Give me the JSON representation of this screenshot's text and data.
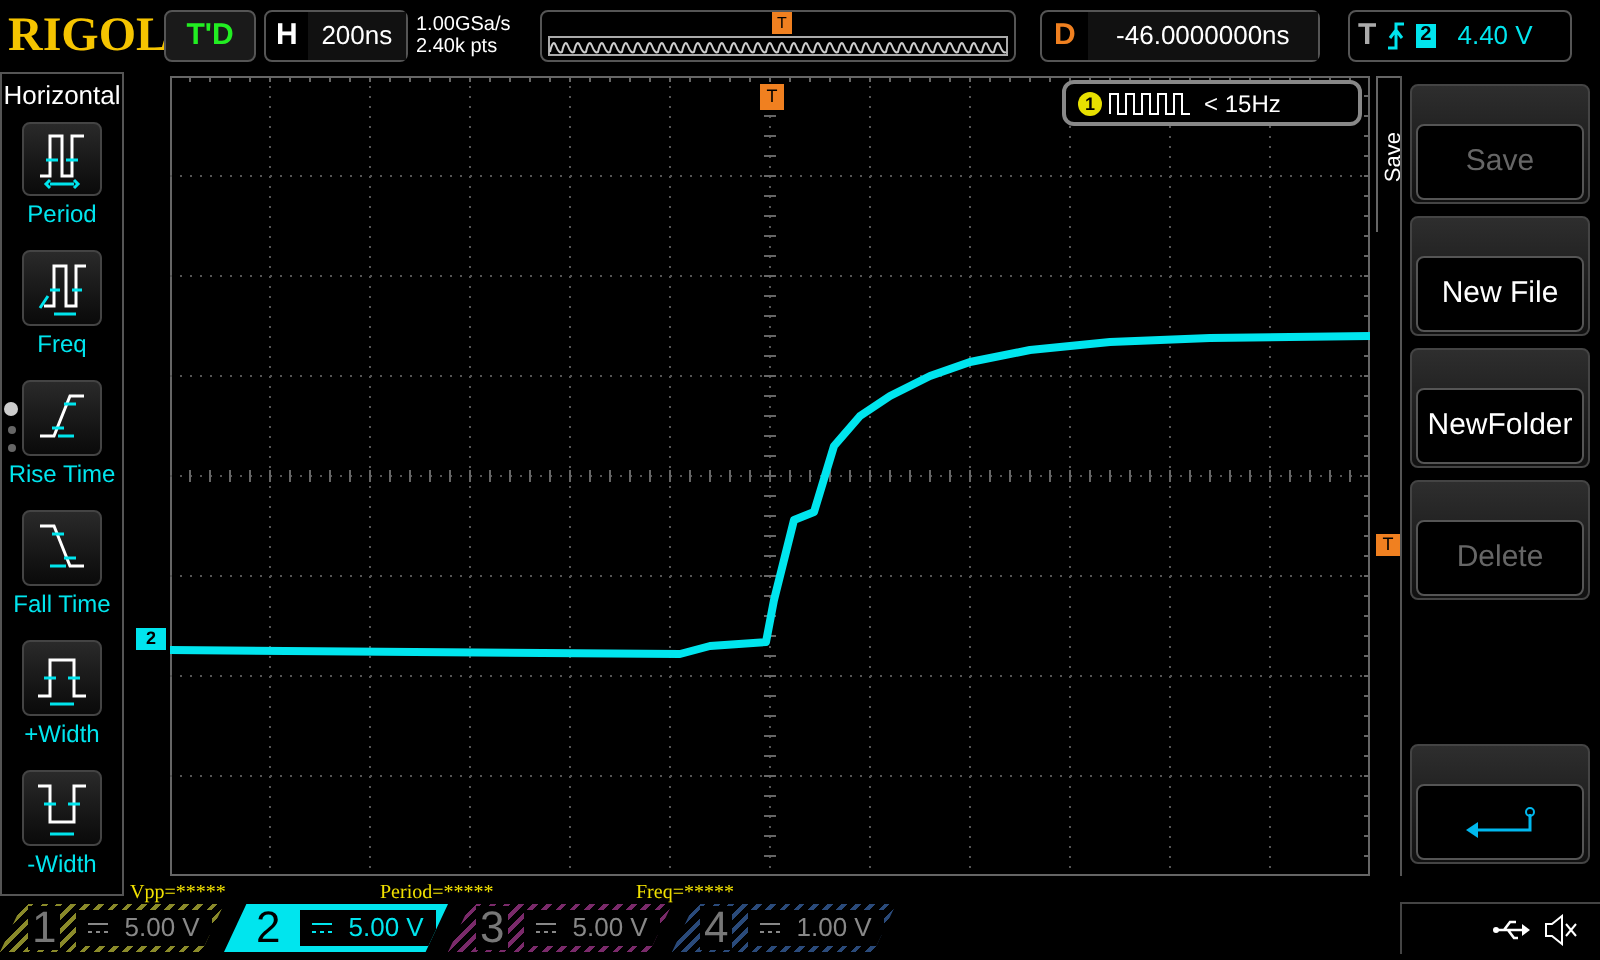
{
  "brand": "RIGOL",
  "run_status": "T'D",
  "timebase": {
    "label": "H",
    "value": "200ns"
  },
  "acquisition": {
    "sample_rate": "1.00GSa/s",
    "memory_depth": "2.40k pts"
  },
  "overview": {
    "trigger_marker": "T"
  },
  "delay": {
    "label": "D",
    "value": "-46.0000000ns"
  },
  "trigger": {
    "label": "T",
    "source": "2",
    "level": "4.40 V"
  },
  "measure_panel": {
    "title": "Horizontal",
    "items": [
      {
        "kind": "period",
        "label": "Period"
      },
      {
        "kind": "freq",
        "label": "Freq"
      },
      {
        "kind": "rise",
        "label": "Rise Time"
      },
      {
        "kind": "fall",
        "label": "Fall Time"
      },
      {
        "kind": "pwidth",
        "label": "+Width"
      },
      {
        "kind": "nwidth",
        "label": "-Width"
      }
    ],
    "pages": [
      {
        "selected": true
      },
      {
        "selected": false
      },
      {
        "selected": false
      }
    ]
  },
  "screen": {
    "trigger_position_marker": "T",
    "trigger_level_marker": "T",
    "channel_marker": "2",
    "counter": {
      "channel": "1",
      "reading": "< 15Hz"
    }
  },
  "measurements": [
    "Vpp=*****",
    "Period=*****",
    "Freq=*****"
  ],
  "menu": {
    "title": "Save",
    "buttons": [
      {
        "label": "Save",
        "disabled": true
      },
      {
        "label": "New File",
        "disabled": false
      },
      {
        "label": "NewFolder",
        "disabled": false
      },
      {
        "label": "Delete",
        "disabled": true
      }
    ]
  },
  "channels": [
    {
      "number": "1",
      "scale": "5.00 V",
      "selected": false,
      "color": "#8a8a2a"
    },
    {
      "number": "2",
      "scale": "5.00 V",
      "selected": true,
      "color": "#00e5ee"
    },
    {
      "number": "3",
      "scale": "5.00 V",
      "selected": false,
      "color": "#7a2a6a"
    },
    {
      "number": "4",
      "scale": "1.00 V",
      "selected": false,
      "color": "#2a4a7a"
    }
  ]
}
